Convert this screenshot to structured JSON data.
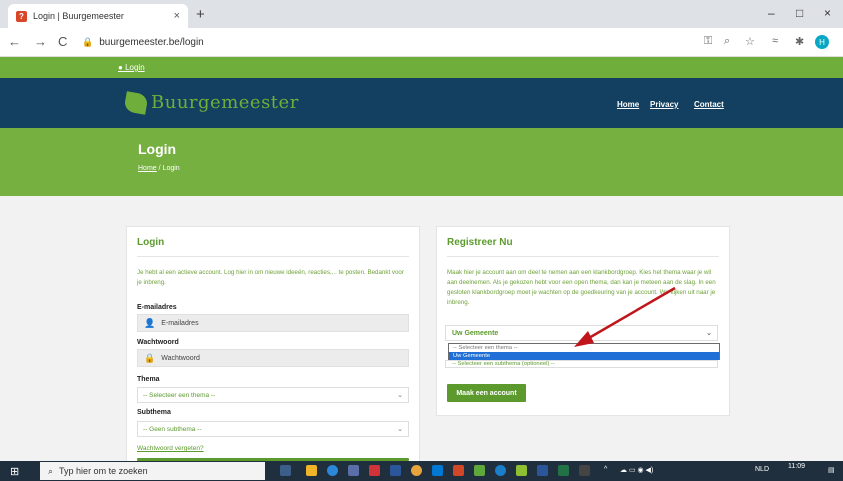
{
  "browser": {
    "tab_title": "Login | Buurgemeester",
    "tab_close": "×",
    "new_tab": "+",
    "url": "buurgemeester.be/login",
    "back": "←",
    "forward": "→",
    "reload": "C",
    "minimize": "–",
    "maximize": "□",
    "close": "×",
    "profile_initial": "H"
  },
  "site": {
    "top_login_link": "Login",
    "logo_text": "Buurgemeester",
    "menu": [
      "Home",
      "Privacy",
      "Contact"
    ],
    "page_title": "Login",
    "breadcrumb_home": "Home",
    "breadcrumb_sep": "/",
    "breadcrumb_current": "Login"
  },
  "login_card": {
    "title": "Login",
    "intro": "Je hebt al een actieve account. Log hier in om nieuwe ideeën, reacties,... te posten. Bedankt voor je inbreng.",
    "email_label": "E-mailadres",
    "email_placeholder": "E-mailadres",
    "password_label": "Wachtwoord",
    "password_placeholder": "Wachtwoord",
    "theme_label": "Thema",
    "theme_value": "-- Selecteer een thema --",
    "subtheme_label": "Subthema",
    "subtheme_value": "-- Geen subthema --",
    "forgot_link": "Wachtwoord vergeten?"
  },
  "register_card": {
    "title": "Registreer Nu",
    "intro": "Maak hier je account aan om deel te nemen aan een klankbordgroep. Kies het thema waar je wil aan deelnemen. Als je gekozen hebt voor een open thema, dan kan je meteen aan de slag. In een gesloten klankbordgroep moet je wachten op de goedkeuring van je account. We kijken uit naar je inbreng.",
    "municipality_select": "Uw Gemeente",
    "dropdown_options": [
      "-- Selecteer een thema --",
      "Uw Gemeente"
    ],
    "dropdown_selected_index": 1,
    "subtheme_peek": "-- Selecteer een subthema (optioneel) --",
    "submit_label": "Maak een account"
  },
  "taskbar": {
    "search_placeholder": "Typ hier om te zoeken",
    "language": "NLD",
    "time": "11:09"
  },
  "colors": {
    "brand_green": "#6fae3a",
    "navy": "#134060",
    "link_green": "#5c9a2e",
    "annotation_arrow": "#c0161b"
  }
}
